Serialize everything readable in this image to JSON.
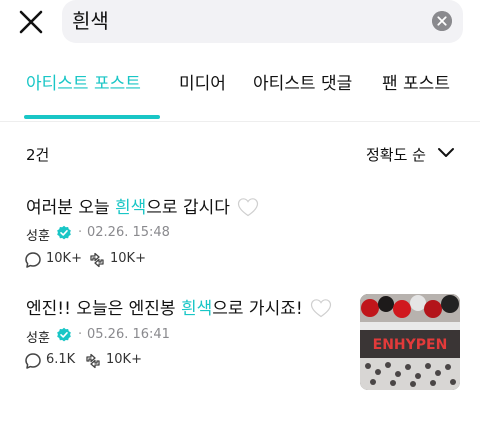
{
  "search": {
    "query": "흰색"
  },
  "tabs": [
    {
      "label": "아티스트 포스트",
      "active": true
    },
    {
      "label": "미디어",
      "active": false
    },
    {
      "label": "아티스트 댓글",
      "active": false
    },
    {
      "label": "팬 포스트",
      "active": false
    }
  ],
  "results": {
    "count": "2건",
    "sort_label": "정확도 순"
  },
  "posts": [
    {
      "text_before": "여러분 오늘 ",
      "highlight": "흰색",
      "text_after": "으로 갑시다",
      "author": "성훈",
      "date": "02.26. 15:48",
      "comments": "10K+",
      "likes": "10K+",
      "has_image": false
    },
    {
      "text_before": "엔진!! 오늘은 엔진봉 ",
      "highlight": "흰색",
      "text_after": "으로 가시죠!",
      "author": "성훈",
      "date": "05.26. 16:41",
      "comments": "6.1K",
      "likes": "10K+",
      "has_image": true,
      "image_text": "ENHYPEN"
    }
  ],
  "colors": {
    "accent": "#19c6c6",
    "verified": "#19c6c6",
    "search_bg": "#f2f2f5"
  },
  "icons": {
    "close": "close-icon",
    "clear": "clear-icon",
    "sort": "chevron-down-icon",
    "verified": "verified-badge-icon",
    "comment": "comment-icon",
    "like": "like-icon",
    "heart": "white-heart-emoji"
  }
}
